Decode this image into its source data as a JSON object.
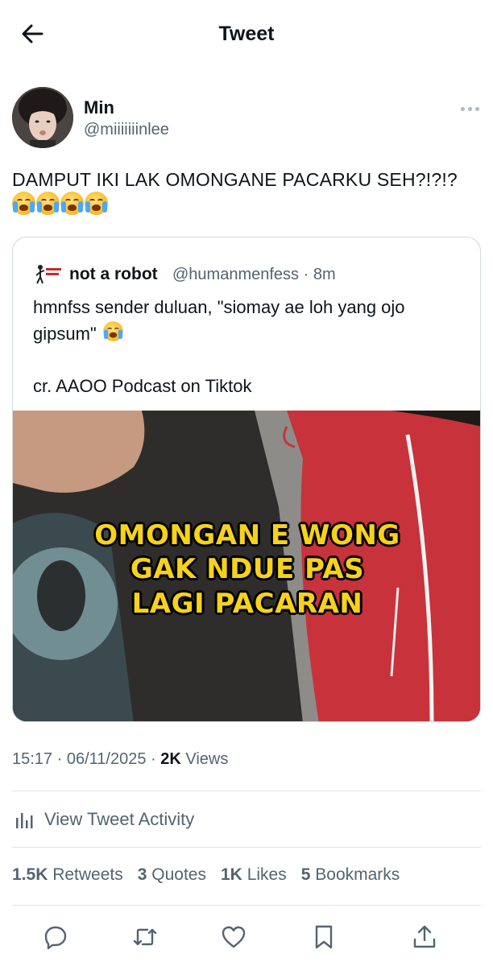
{
  "header": {
    "title": "Tweet",
    "back_icon": "arrow-left-icon"
  },
  "author": {
    "name": "Min",
    "handle": "@miiiiiiinlee"
  },
  "tweet": {
    "text": "DAMPUT IKI LAK OMONGANE PACARKU SEH?!?!?",
    "emojis": [
      "loudly-crying-face",
      "loudly-crying-face",
      "loudly-crying-face",
      "loudly-crying-face"
    ]
  },
  "quote": {
    "name": "not a robot",
    "meta": "@humanmenfess · 8m",
    "text": "hmnfss sender duluan, \"siomay ae loh yang ojo gipsum\"",
    "credit": "cr. AAOO Podcast on Tiktok",
    "media_caption": [
      "OMONGAN E WONG",
      "GAK NDUE PAS",
      "LAGI PACARAN"
    ]
  },
  "timestamp": {
    "time_date": "15:17 · 06/11/2025 · ",
    "views_count": "2K",
    "views_label": "Views"
  },
  "activity": {
    "label": "View Tweet Activity"
  },
  "stats": {
    "retweets_count": "1.5K",
    "retweets_label": "Retweets",
    "quotes_count": "3",
    "quotes_label": "Quotes",
    "likes_count": "1K",
    "likes_label": "Likes",
    "bookmarks_count": "5",
    "bookmarks_label": "Bookmarks"
  },
  "actions": [
    "reply-icon",
    "retweet-icon",
    "like-icon",
    "bookmark-icon",
    "share-icon"
  ],
  "colors": {
    "text": "#0f1419",
    "secondary": "#536471",
    "border": "#cfd9de",
    "caption": "#f7d21a"
  }
}
